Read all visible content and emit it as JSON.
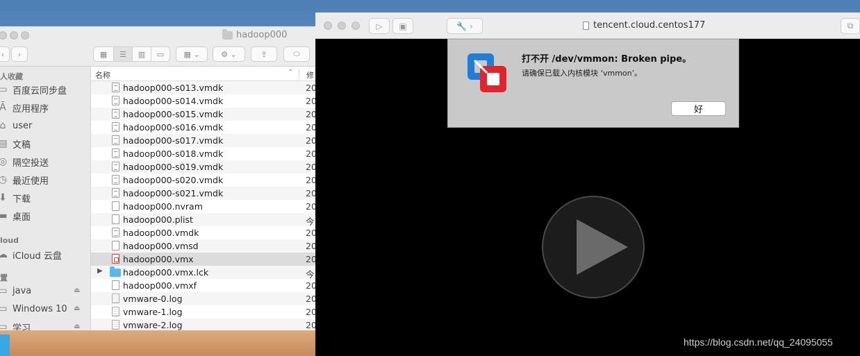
{
  "finder": {
    "title": "hadoop000",
    "header": {
      "name_col": "名称",
      "date_col": "修"
    },
    "sidebar": {
      "favorites_label": "人收藏",
      "favorites": [
        {
          "label": "百度云同步盘",
          "icon": "folder-icon"
        },
        {
          "label": "应用程序",
          "icon": "applications-icon"
        },
        {
          "label": "user",
          "icon": "home-icon"
        },
        {
          "label": "文稿",
          "icon": "documents-icon"
        },
        {
          "label": "隔空投送",
          "icon": "airdrop-icon"
        },
        {
          "label": "最近使用",
          "icon": "recents-icon"
        },
        {
          "label": "下载",
          "icon": "downloads-icon"
        },
        {
          "label": "桌面",
          "icon": "desktop-icon"
        }
      ],
      "icloud_label": "loud",
      "icloud": [
        {
          "label": "iCloud 云盘",
          "icon": "cloud-icon"
        }
      ],
      "locations_label": "置",
      "locations": [
        {
          "label": "java",
          "icon": "disk-icon"
        },
        {
          "label": "Windows 10",
          "icon": "disk-icon"
        },
        {
          "label": "学习",
          "icon": "disk-icon"
        }
      ]
    },
    "files": [
      {
        "name": "hadoop000-s013.vmdk",
        "date": "20",
        "type": "doc"
      },
      {
        "name": "hadoop000-s014.vmdk",
        "date": "20",
        "type": "doc"
      },
      {
        "name": "hadoop000-s015.vmdk",
        "date": "20",
        "type": "doc"
      },
      {
        "name": "hadoop000-s016.vmdk",
        "date": "20",
        "type": "doc"
      },
      {
        "name": "hadoop000-s017.vmdk",
        "date": "20",
        "type": "doc"
      },
      {
        "name": "hadoop000-s018.vmdk",
        "date": "20",
        "type": "doc"
      },
      {
        "name": "hadoop000-s019.vmdk",
        "date": "20",
        "type": "doc"
      },
      {
        "name": "hadoop000-s020.vmdk",
        "date": "20",
        "type": "doc"
      },
      {
        "name": "hadoop000-s021.vmdk",
        "date": "20",
        "type": "doc"
      },
      {
        "name": "hadoop000.nvram",
        "date": "20",
        "type": "blank"
      },
      {
        "name": "hadoop000.plist",
        "date": "今",
        "type": "blank"
      },
      {
        "name": "hadoop000.vmdk",
        "date": "20",
        "type": "doc"
      },
      {
        "name": "hadoop000.vmsd",
        "date": "20",
        "type": "blank"
      },
      {
        "name": "hadoop000.vmx",
        "date": "20",
        "type": "vmx",
        "selected": true
      },
      {
        "name": "hadoop000.vmx.lck",
        "date": "今",
        "type": "folder"
      },
      {
        "name": "hadoop000.vmxf",
        "date": "20",
        "type": "blank"
      },
      {
        "name": "vmware-0.log",
        "date": "20",
        "type": "log"
      },
      {
        "name": "vmware-1.log",
        "date": "20",
        "type": "log"
      },
      {
        "name": "vmware-2.log",
        "date": "20",
        "type": "log"
      }
    ]
  },
  "vmware": {
    "title": "tencent.cloud.centos177",
    "dialog": {
      "title": "打不开 /dev/vmmon: Broken pipe。",
      "message": "请确保已载入内核模块 ‘vmmon’。",
      "ok_label": "好"
    }
  },
  "watermark": "https://blog.csdn.net/qq_24095055",
  "colors": {
    "folder_blue": "#5bb8ef",
    "selected_row": "#dcdcdc",
    "vm_background": "#000000",
    "dialog_background": "#c9c9c9",
    "vmware_logo_blue": "#1f7fd6",
    "vmware_logo_red": "#e0262c"
  }
}
